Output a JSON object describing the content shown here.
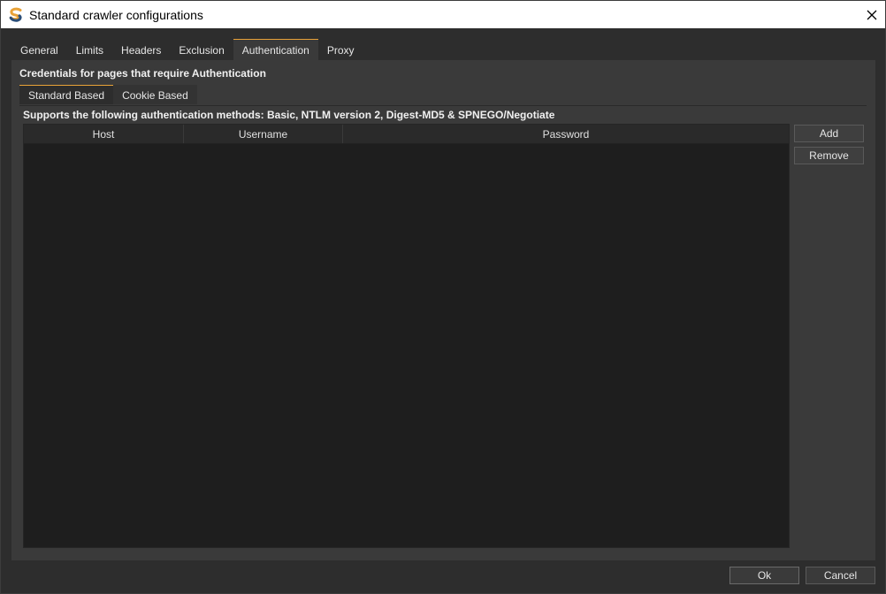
{
  "window": {
    "title": "Standard crawler configurations",
    "icon": "app-s-logo-icon",
    "close_glyph": "✕"
  },
  "main_tabs": [
    {
      "label": "General"
    },
    {
      "label": "Limits"
    },
    {
      "label": "Headers"
    },
    {
      "label": "Exclusion"
    },
    {
      "label": "Authentication",
      "active": true
    },
    {
      "label": "Proxy"
    }
  ],
  "panel": {
    "section_title": "Credentials for pages that require Authentication",
    "sub_tabs": [
      {
        "label": "Standard Based",
        "active": true
      },
      {
        "label": "Cookie Based"
      }
    ],
    "methods_text": "Supports the following authentication methods: Basic, NTLM version 2, Digest-MD5 & SPNEGO/Negotiate",
    "table": {
      "columns": [
        "Host",
        "Username",
        "Password"
      ],
      "rows": []
    },
    "buttons": {
      "add": "Add",
      "remove": "Remove"
    }
  },
  "footer": {
    "ok": "Ok",
    "cancel": "Cancel"
  },
  "colors": {
    "accent": "#e8a238",
    "background": "#2d2d2d",
    "panel": "#3a3a3a",
    "table": "#1e1e1e"
  }
}
